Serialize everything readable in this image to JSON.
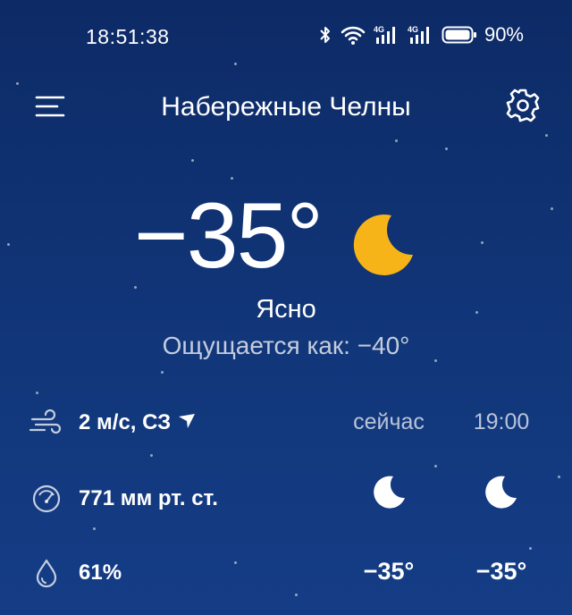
{
  "status_bar": {
    "time": "18:51:38",
    "battery": "90%",
    "icons": [
      "bluetooth-icon",
      "wifi-icon",
      "signal-4g-icon",
      "signal-4g-icon",
      "battery-icon"
    ]
  },
  "header": {
    "city": "Набережные Челны",
    "menu_icon": "hamburger-menu-icon",
    "settings_icon": "gear-icon"
  },
  "current": {
    "temperature": "−35°",
    "condition": "Ясно",
    "feels_like": "Ощущается как: −40°",
    "icon": "moon-icon"
  },
  "details": {
    "wind": "2 м/с, СЗ",
    "pressure": "771 мм рт. ст.",
    "humidity": "61%"
  },
  "hourly": [
    {
      "label": "сейчас",
      "icon": "moon-icon",
      "temp": "−35°"
    },
    {
      "label": "19:00",
      "icon": "moon-icon",
      "temp": "−35°"
    }
  ],
  "colors": {
    "background_top": "#0d2a66",
    "background_bottom": "#153d86",
    "moon_big": "#f7b419",
    "text": "#ffffff"
  }
}
